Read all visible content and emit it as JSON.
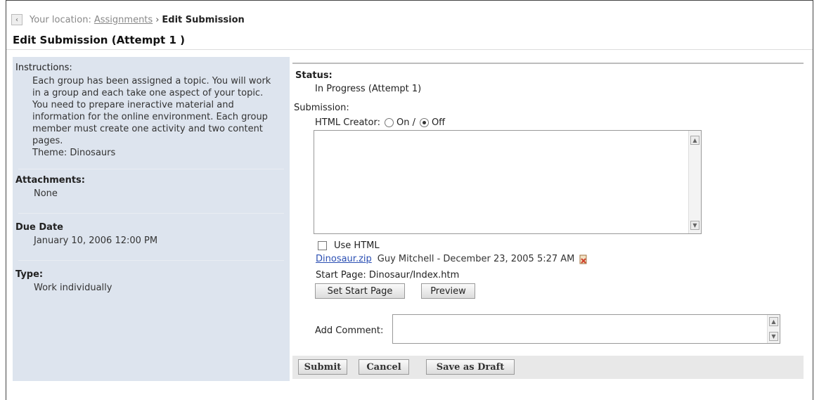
{
  "breadcrumb": {
    "prefix": "Your location:",
    "parent": "Assignments",
    "separator": "›",
    "current": "Edit Submission"
  },
  "page_title": "Edit Submission (Attempt 1 )",
  "sidebar": {
    "instructions_label": "Instructions:",
    "instructions_text": "Each group has been assigned a topic. You will work in a group and each take one aspect of your topic. You need to prepare ineractive material and information for the online environment. Each group member must create one activity and two content pages.",
    "theme": "Theme: Dinosaurs",
    "attachments_label": "Attachments:",
    "attachments_value": "None",
    "due_date_label": "Due Date",
    "due_date_value": "January 10, 2006 12:00 PM",
    "type_label": "Type:",
    "type_value": "Work individually"
  },
  "main": {
    "status_label": "Status:",
    "status_value": "In Progress (Attempt 1)",
    "submission_label": "Submission:",
    "html_creator_label": "HTML Creator:",
    "html_creator_on": "On /",
    "html_creator_off": "Off",
    "html_creator_selected": "Off",
    "use_html_label": "Use HTML",
    "file_name": "Dinosaur.zip",
    "file_meta": "Guy Mitchell  -  December 23, 2005 5:27 AM",
    "start_page": "Start Page: Dinosaur/Index.htm",
    "set_start_page_button": "Set Start Page",
    "preview_button": "Preview",
    "add_comment_label": "Add Comment:"
  },
  "actions": {
    "submit": "Submit",
    "cancel": "Cancel",
    "save_draft": "Save as Draft"
  }
}
